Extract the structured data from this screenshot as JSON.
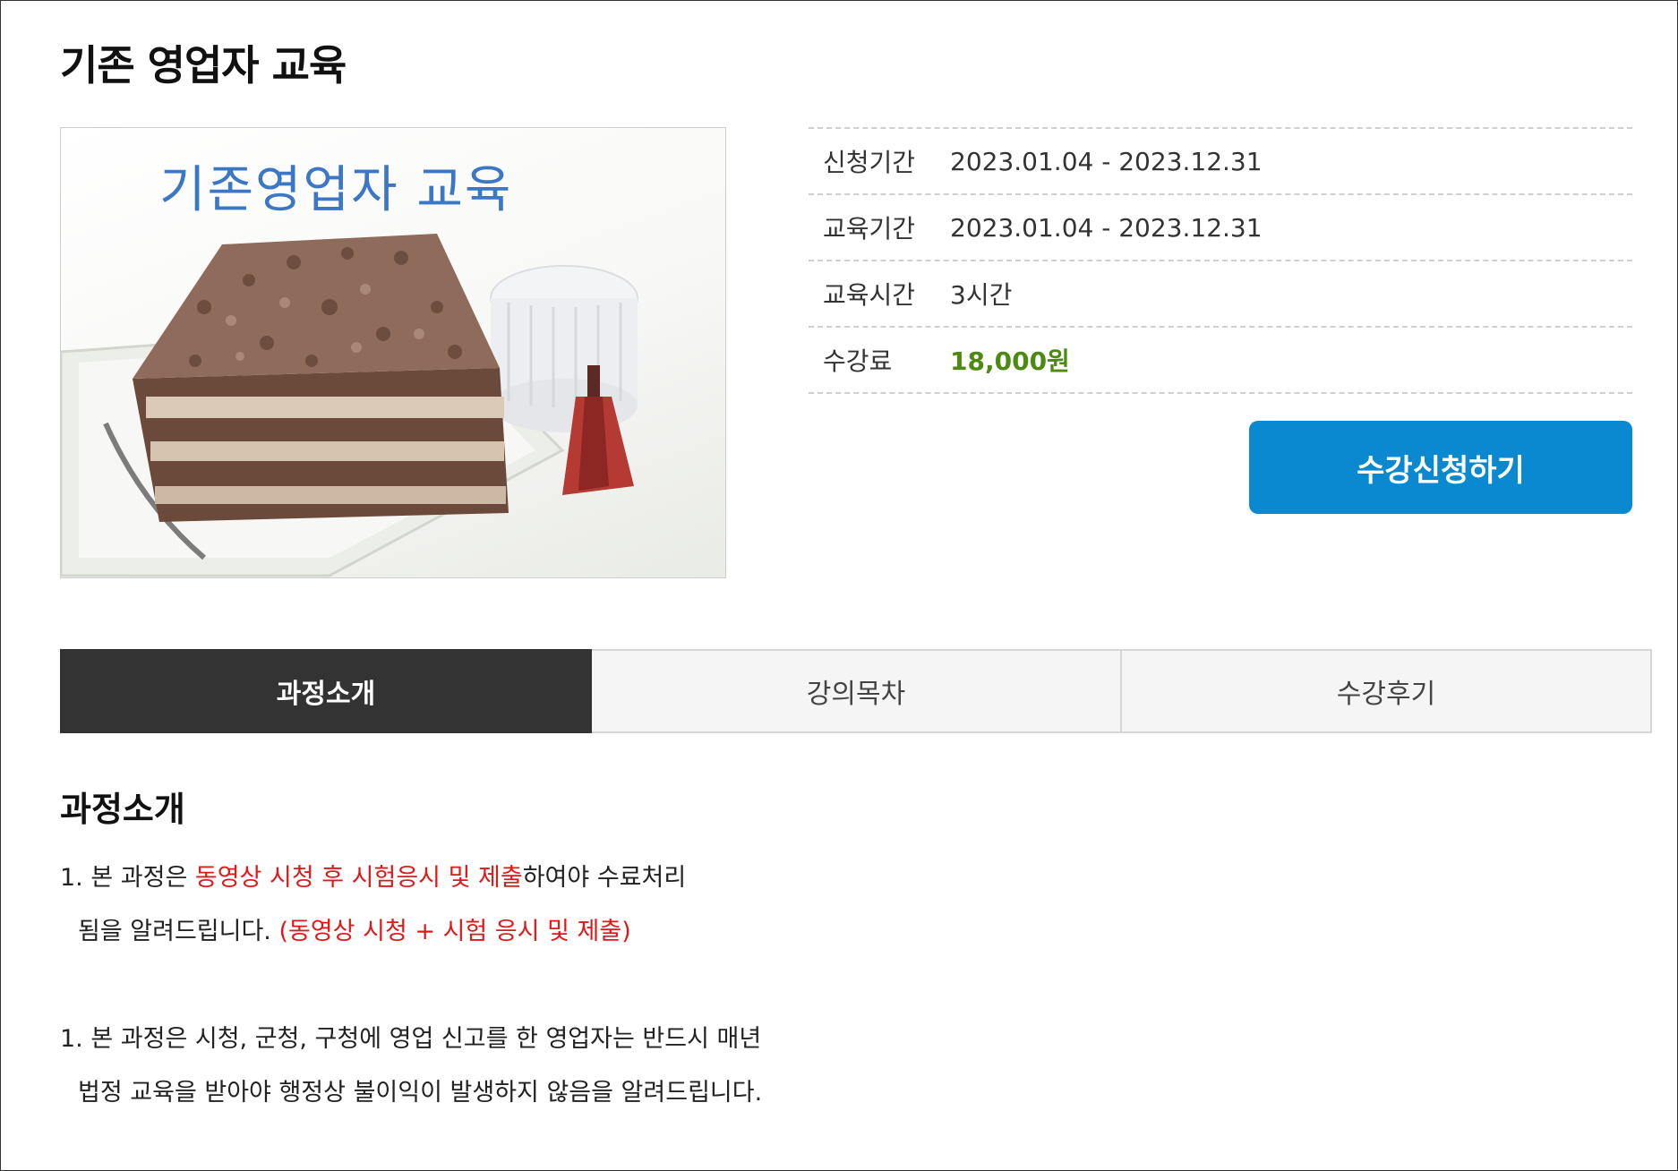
{
  "page": {
    "title": "기존 영업자 교육"
  },
  "thumbnail": {
    "caption": "기존영업자 교육"
  },
  "info": [
    {
      "label": "신청기간",
      "value": "2023.01.04 - 2023.12.31"
    },
    {
      "label": "교육기간",
      "value": "2023.01.04 - 2023.12.31"
    },
    {
      "label": "교육시간",
      "value": "3시간"
    },
    {
      "label": "수강료",
      "value": "18,000원"
    }
  ],
  "apply_button": {
    "label": "수강신청하기"
  },
  "tabs": [
    {
      "label": "과정소개",
      "active": true
    },
    {
      "label": "강의목차",
      "active": false
    },
    {
      "label": "수강후기",
      "active": false
    }
  ],
  "section": {
    "title": "과정소개",
    "p1": {
      "prefix": "1. 본 과정은  ",
      "highlight": "동영상 시청 후  시험응시 및 제출",
      "suffix": "하여야 수료처리",
      "line2_text": "됨을 알려드립니다.  ",
      "line2_highlight": "(동영상 시청 + 시험 응시 및 제출)"
    },
    "p2": {
      "line1": "1. 본 과정은 시청, 군청, 구청에  영업 신고를 한  영업자는 반드시 매년",
      "line2": "법정 교육을  받아야 행정상 불이익이 발생하지 않음을 알려드립니다."
    }
  },
  "colors": {
    "accent_blue": "#0a89d0",
    "price_green": "#4c8a12",
    "highlight_red": "#e01818",
    "active_tab": "#333333"
  }
}
